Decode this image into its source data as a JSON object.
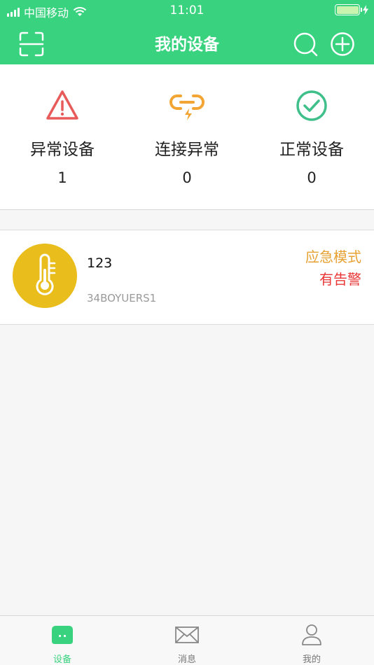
{
  "status_bar": {
    "carrier": "中国移动",
    "time": "11:01"
  },
  "navbar": {
    "title": "我的设备",
    "left_icon": "scan-icon",
    "right_icons": [
      "search-icon",
      "add-icon"
    ]
  },
  "stats": [
    {
      "label": "异常设备",
      "count": "1",
      "icon": "warning-triangle-icon",
      "color": "#e85b5b"
    },
    {
      "label": "连接异常",
      "count": "0",
      "icon": "broken-link-icon",
      "color": "#f2a533"
    },
    {
      "label": "正常设备",
      "count": "0",
      "icon": "check-circle-icon",
      "color": "#3fbf8a"
    }
  ],
  "devices": [
    {
      "name": "123",
      "id": "34BOYUERS1",
      "mode": "应急模式",
      "alarm": "有告警",
      "icon": "thermometer-icon",
      "icon_bg": "#e9bd1b"
    }
  ],
  "tabbar": {
    "tabs": [
      {
        "label": "设备",
        "icon": "device-icon",
        "active": true
      },
      {
        "label": "消息",
        "icon": "envelope-icon",
        "active": false
      },
      {
        "label": "我的",
        "icon": "user-icon",
        "active": false
      }
    ]
  },
  "colors": {
    "brand": "#39d27f",
    "background": "#f6f6f6"
  }
}
